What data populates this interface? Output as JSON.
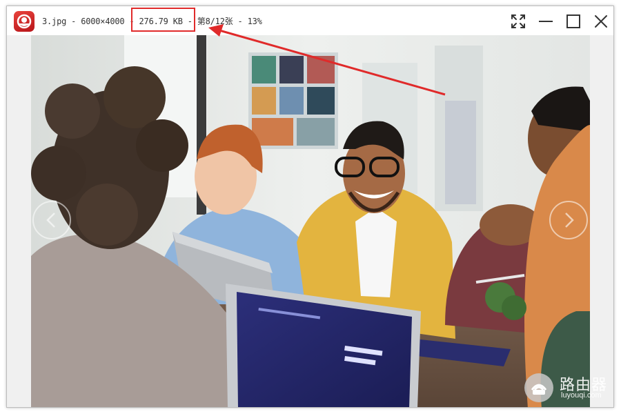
{
  "titlebar": {
    "filename": "3.jpg",
    "dimensions": "6000×4000",
    "filesize": "276.79 KB",
    "position": "第8/12张",
    "zoom": "13%",
    "separator": " - "
  },
  "controls": {
    "fullscreen_icon": "fullscreen-icon",
    "minimize_icon": "minimize-icon",
    "maximize_icon": "maximize-icon",
    "close_icon": "close-icon"
  },
  "viewer": {
    "prev_icon": "chevron-left-icon",
    "next_icon": "chevron-right-icon"
  },
  "watermark": {
    "name_cn": "路由器",
    "name_en": "luyouqi.com"
  },
  "annotation": {
    "color": "#e02a2a"
  }
}
